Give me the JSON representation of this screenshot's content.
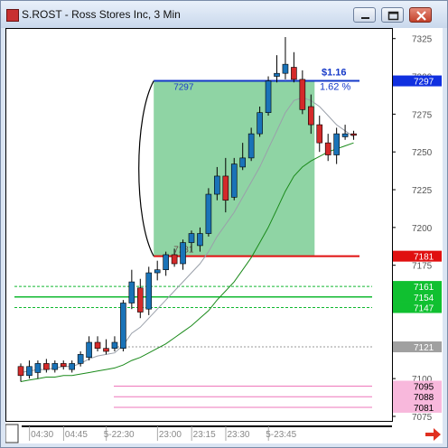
{
  "window": {
    "title": "S.ROST - Ross Stores Inc, 3 Min",
    "minimize_label": "minimize",
    "maximize_label": "maximize",
    "close_label": "close"
  },
  "colors": {
    "up": "#1a73b8",
    "down": "#d42a2a",
    "fast_ma": "#9aa0aa",
    "slow_ma": "#1a8a1a",
    "green_box": "#8fd4a4",
    "blue_line": "#1438c8",
    "red_line": "#e01010",
    "green_levels": "#10b830",
    "pink_levels": "#ee77bb",
    "gray_level": "#999999"
  },
  "chart_data": {
    "type": "candlestick",
    "ylim": [
      7072,
      7332
    ],
    "y_ticks": [
      {
        "value": 7325,
        "label": "7325"
      },
      {
        "value": 7300,
        "label": "7300"
      },
      {
        "value": 7275,
        "label": "7275"
      },
      {
        "value": 7250,
        "label": "7250"
      },
      {
        "value": 7225,
        "label": "7225"
      },
      {
        "value": 7200,
        "label": "7200"
      },
      {
        "value": 7175,
        "label": "7175"
      },
      {
        "value": 7100,
        "label": "7100"
      },
      {
        "value": 7075,
        "label": "7075"
      }
    ],
    "x_labels": [
      {
        "index": 2.5,
        "label": "04:30"
      },
      {
        "index": 6.5,
        "label": "04:45"
      },
      {
        "index": 11.5,
        "label": "5-22:30"
      },
      {
        "index": 17.5,
        "label": "23:00"
      },
      {
        "index": 21.5,
        "label": "23:15"
      },
      {
        "index": 25.5,
        "label": "23:30"
      },
      {
        "index": 30.5,
        "label": "5-23:45"
      }
    ],
    "candles": [
      {
        "o": 7108,
        "h": 7110,
        "l": 7098,
        "c": 7102
      },
      {
        "o": 7102,
        "h": 7112,
        "l": 7100,
        "c": 7108
      },
      {
        "o": 7104,
        "h": 7112,
        "l": 7100,
        "c": 7110
      },
      {
        "o": 7110,
        "h": 7113,
        "l": 7104,
        "c": 7106
      },
      {
        "o": 7106,
        "h": 7112,
        "l": 7104,
        "c": 7110
      },
      {
        "o": 7110,
        "h": 7112,
        "l": 7106,
        "c": 7108
      },
      {
        "o": 7106,
        "h": 7112,
        "l": 7104,
        "c": 7110
      },
      {
        "o": 7110,
        "h": 7118,
        "l": 7108,
        "c": 7116
      },
      {
        "o": 7114,
        "h": 7128,
        "l": 7112,
        "c": 7124
      },
      {
        "o": 7124,
        "h": 7128,
        "l": 7118,
        "c": 7120
      },
      {
        "o": 7120,
        "h": 7126,
        "l": 7116,
        "c": 7118
      },
      {
        "o": 7120,
        "h": 7128,
        "l": 7118,
        "c": 7124
      },
      {
        "o": 7120,
        "h": 7152,
        "l": 7118,
        "c": 7150
      },
      {
        "o": 7150,
        "h": 7172,
        "l": 7146,
        "c": 7164
      },
      {
        "o": 7160,
        "h": 7166,
        "l": 7140,
        "c": 7144
      },
      {
        "o": 7146,
        "h": 7174,
        "l": 7142,
        "c": 7170
      },
      {
        "o": 7170,
        "h": 7178,
        "l": 7165,
        "c": 7172
      },
      {
        "o": 7172,
        "h": 7184,
        "l": 7168,
        "c": 7182
      },
      {
        "o": 7182,
        "h": 7186,
        "l": 7174,
        "c": 7176
      },
      {
        "o": 7176,
        "h": 7192,
        "l": 7172,
        "c": 7190
      },
      {
        "o": 7190,
        "h": 7198,
        "l": 7184,
        "c": 7196
      },
      {
        "o": 7188,
        "h": 7200,
        "l": 7184,
        "c": 7196
      },
      {
        "o": 7196,
        "h": 7226,
        "l": 7194,
        "c": 7222
      },
      {
        "o": 7222,
        "h": 7240,
        "l": 7218,
        "c": 7234
      },
      {
        "o": 7234,
        "h": 7246,
        "l": 7210,
        "c": 7218
      },
      {
        "o": 7220,
        "h": 7246,
        "l": 7218,
        "c": 7242
      },
      {
        "o": 7240,
        "h": 7256,
        "l": 7238,
        "c": 7246
      },
      {
        "o": 7246,
        "h": 7266,
        "l": 7244,
        "c": 7262
      },
      {
        "o": 7262,
        "h": 7280,
        "l": 7260,
        "c": 7276
      },
      {
        "o": 7276,
        "h": 7300,
        "l": 7274,
        "c": 7297
      },
      {
        "o": 7300,
        "h": 7314,
        "l": 7296,
        "c": 7302
      },
      {
        "o": 7302,
        "h": 7326,
        "l": 7298,
        "c": 7308
      },
      {
        "o": 7306,
        "h": 7316,
        "l": 7296,
        "c": 7298
      },
      {
        "o": 7298,
        "h": 7304,
        "l": 7275,
        "c": 7278
      },
      {
        "o": 7280,
        "h": 7288,
        "l": 7262,
        "c": 7268
      },
      {
        "o": 7268,
        "h": 7274,
        "l": 7250,
        "c": 7256
      },
      {
        "o": 7256,
        "h": 7262,
        "l": 7244,
        "c": 7248
      },
      {
        "o": 7248,
        "h": 7266,
        "l": 7242,
        "c": 7262
      },
      {
        "o": 7260,
        "h": 7268,
        "l": 7258,
        "c": 7262
      },
      {
        "o": 7262,
        "h": 7264,
        "l": 7258,
        "c": 7261
      }
    ],
    "fast_ma": [
      7104,
      7105,
      7106,
      7106,
      7107,
      7108,
      7108,
      7110,
      7113,
      7115,
      7116,
      7117,
      7122,
      7130,
      7134,
      7140,
      7146,
      7152,
      7158,
      7164,
      7170,
      7176,
      7184,
      7194,
      7202,
      7210,
      7220,
      7230,
      7240,
      7252,
      7264,
      7276,
      7284,
      7286,
      7284,
      7280,
      7274,
      7268,
      7264,
      7260
    ],
    "slow_ma": [
      7098,
      7099,
      7100,
      7101,
      7101,
      7102,
      7102,
      7103,
      7104,
      7105,
      7106,
      7107,
      7109,
      7112,
      7114,
      7117,
      7120,
      7123,
      7127,
      7131,
      7135,
      7140,
      7145,
      7152,
      7158,
      7164,
      7172,
      7180,
      7190,
      7200,
      7212,
      7224,
      7234,
      7240,
      7244,
      7247,
      7250,
      7252,
      7254,
      7256
    ],
    "annotation": {
      "high": 7297,
      "low": 7181,
      "high_label": "7297",
      "low_label": "7181",
      "change_label": "$1.16",
      "percent_label": "1.62 %",
      "start_index": 16,
      "end_index": 34
    },
    "levels": [
      {
        "value": 7297,
        "label": "7297",
        "color": "#1030e0",
        "style": "marker"
      },
      {
        "value": 7181,
        "label": "7181",
        "color": "#e01010",
        "style": "marker"
      },
      {
        "value": 7161,
        "label": "7161",
        "color": "#10c030",
        "style": "dashed"
      },
      {
        "value": 7154,
        "label": "7154",
        "color": "#10c030",
        "style": "solid"
      },
      {
        "value": 7147,
        "label": "7147",
        "color": "#10c030",
        "style": "dashed"
      },
      {
        "value": 7121,
        "label": "7121",
        "color": "#9a9a9a",
        "style": "gray"
      },
      {
        "value": 7095,
        "label": "7095",
        "color": "#f8b8dc",
        "style": "pink"
      },
      {
        "value": 7088,
        "label": "7088",
        "color": "#f8b8dc",
        "style": "pink"
      },
      {
        "value": 7081,
        "label": "7081",
        "color": "#f8b8dc",
        "style": "pink"
      }
    ]
  }
}
